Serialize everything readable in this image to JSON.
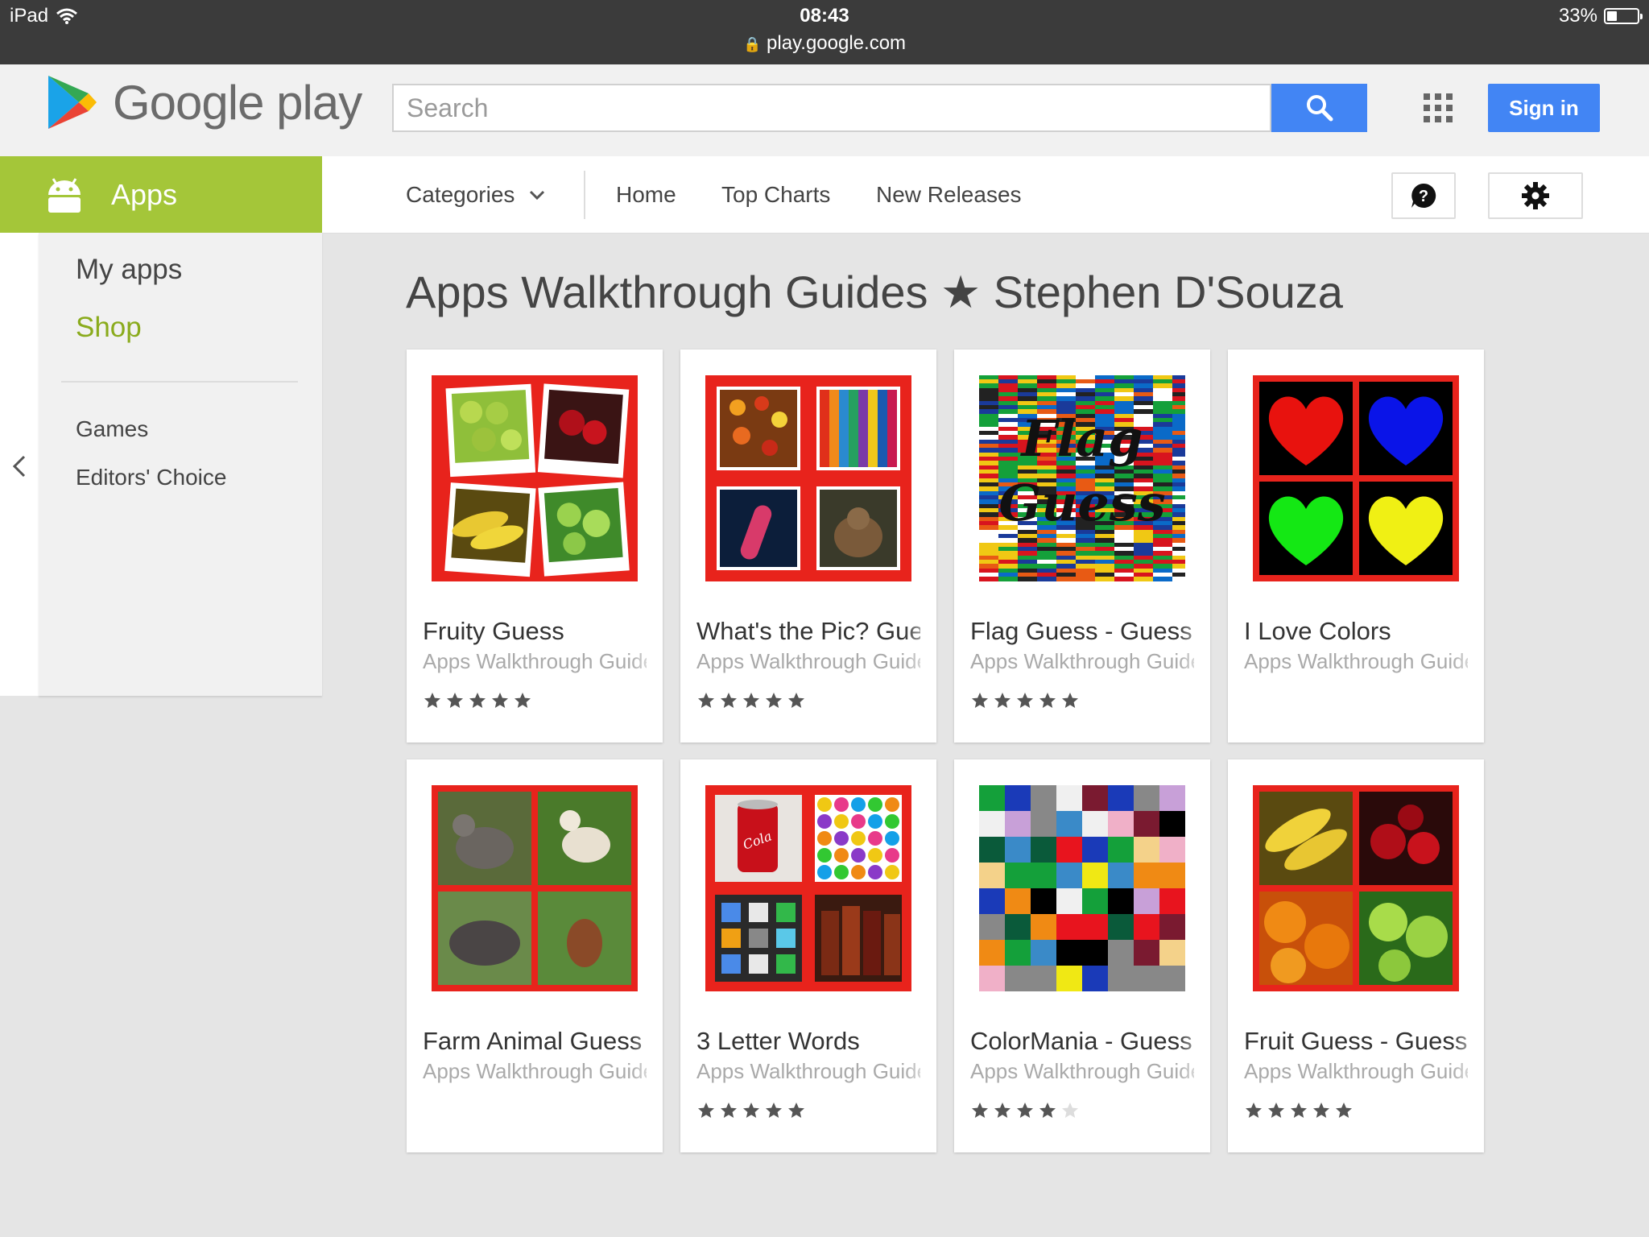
{
  "status_bar": {
    "device": "iPad",
    "time": "08:43",
    "url": "play.google.com",
    "battery": "33%",
    "battery_level": 0.33
  },
  "header": {
    "logo_text": "Google play",
    "search_placeholder": "Search",
    "sign_in": "Sign in"
  },
  "nav": {
    "apps_tab": "Apps",
    "categories": "Categories",
    "home": "Home",
    "top_charts": "Top Charts",
    "new_releases": "New Releases"
  },
  "sidebar": {
    "my_apps": "My apps",
    "shop": "Shop",
    "games": "Games",
    "editors_choice": "Editors' Choice"
  },
  "page": {
    "title": "Apps Walkthrough Guides ★ Stephen D'Souza"
  },
  "apps": [
    {
      "title": "Fruity Guess",
      "developer": "Apps Walkthrough Guides",
      "rating": 5,
      "thumb": "fruit-polaroids"
    },
    {
      "title": "What's the Pic? Guess",
      "developer": "Apps Walkthrough Guides",
      "rating": 5,
      "thumb": "pic-collage"
    },
    {
      "title": "Flag Guess - Guess",
      "developer": "Apps Walkthrough Guides",
      "rating": 5,
      "thumb": "flags"
    },
    {
      "title": "I Love Colors",
      "developer": "Apps Walkthrough Guides",
      "rating": 0,
      "thumb": "hearts"
    },
    {
      "title": "Farm Animal Guess",
      "developer": "Apps Walkthrough Guides",
      "rating": 0,
      "thumb": "farm-animals"
    },
    {
      "title": "3 Letter Words",
      "developer": "Apps Walkthrough Guides",
      "rating": 5,
      "thumb": "word-collage"
    },
    {
      "title": "ColorMania - Guess",
      "developer": "Apps Walkthrough Guides",
      "rating": 4,
      "thumb": "color-grid"
    },
    {
      "title": "Fruit Guess - Guess",
      "developer": "Apps Walkthrough Guides",
      "rating": 5,
      "thumb": "fruit-collage"
    }
  ],
  "colors": {
    "apps_green": "#a4c639",
    "primary_blue": "#4285f4"
  }
}
